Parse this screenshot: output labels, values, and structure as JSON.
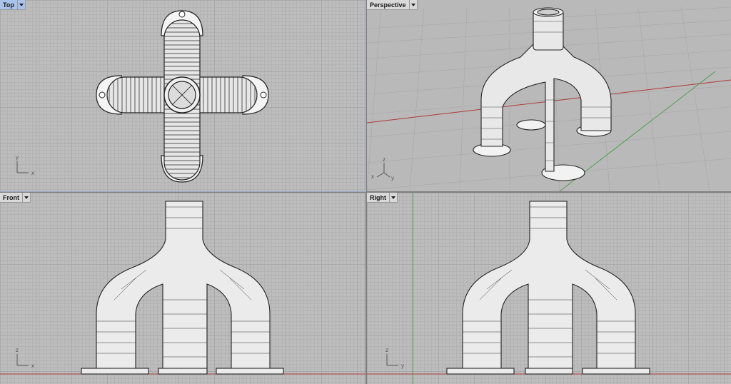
{
  "viewports": {
    "top": {
      "label": "Top",
      "active": true,
      "axes": {
        "v": "y",
        "h": "x"
      }
    },
    "perspective": {
      "label": "Perspective",
      "active": false,
      "axes": {
        "v": "z",
        "h1": "x",
        "h2": "y"
      }
    },
    "front": {
      "label": "Front",
      "active": false,
      "axes": {
        "v": "z",
        "h": "x"
      }
    },
    "right": {
      "label": "Right",
      "active": false,
      "axes": {
        "v": "z",
        "h": "y"
      }
    }
  },
  "colors": {
    "viewport_bg": "#bdbdbd",
    "active_tab": "#a9c3ec",
    "x_axis_line": "#b03a3a",
    "y_axis_line": "#3a9a3a",
    "model_fill": "#ececec",
    "model_stroke": "#222222"
  },
  "icons": {
    "dropdown": "chevron-down-icon"
  }
}
